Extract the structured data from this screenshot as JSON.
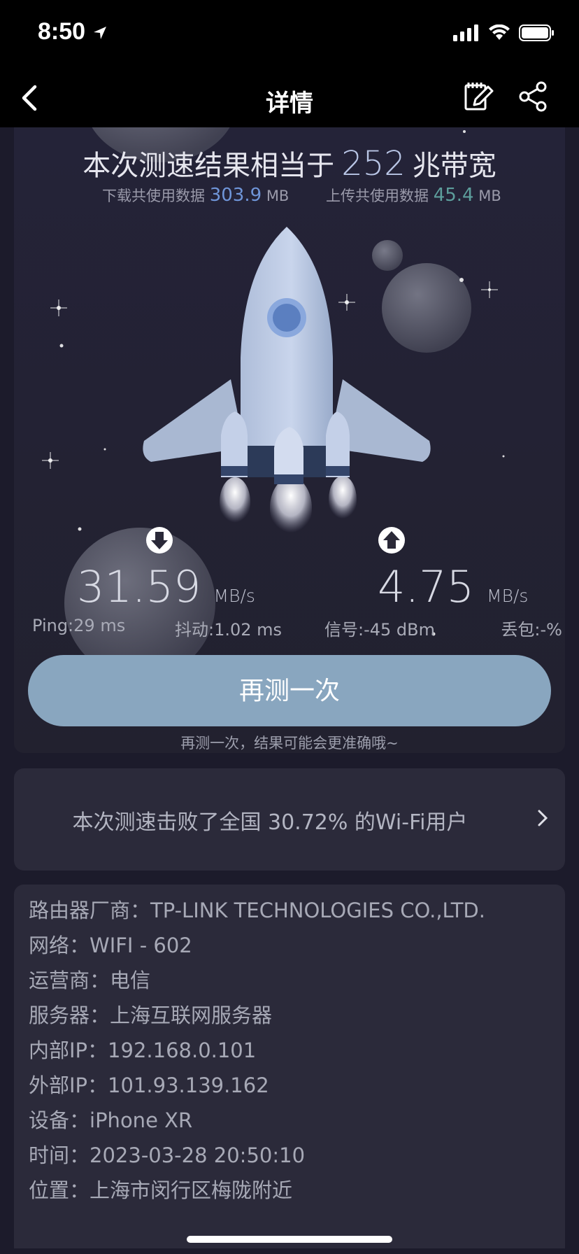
{
  "status": {
    "time": "8:50"
  },
  "nav": {
    "title": "详情"
  },
  "result": {
    "prefix": "本次测速结果相当于",
    "bandwidth": "252",
    "suffix": "兆带宽",
    "download_label": "下载共使用数据",
    "download_value": "303.9",
    "download_unit": "MB",
    "upload_label": "上传共使用数据",
    "upload_value": "45.4",
    "upload_unit": "MB"
  },
  "speeds": {
    "download": "31.59",
    "download_unit": "MB/s",
    "upload": "4.75",
    "upload_unit": "MB/s"
  },
  "metrics": {
    "ping": "Ping:29 ms",
    "jitter": "抖动:1.02 ms",
    "signal": "信号:-45 dBm",
    "loss": "丢包:-%"
  },
  "actions": {
    "retest_label": "再测一次",
    "retest_hint": "再测一次，结果可能会更准确哦~"
  },
  "beat": {
    "text": "本次测速击败了全国 30.72% 的Wi-Fi用户"
  },
  "info": [
    {
      "label": "路由器厂商：",
      "value": "TP-LINK TECHNOLOGIES CO.,LTD."
    },
    {
      "label": "网络：",
      "value": "WIFI - 602"
    },
    {
      "label": "运营商：",
      "value": "电信"
    },
    {
      "label": "服务器：",
      "value": "上海互联网服务器"
    },
    {
      "label": "内部IP：",
      "value": "192.168.0.101"
    },
    {
      "label": "外部IP：",
      "value": "101.93.139.162"
    },
    {
      "label": "设备：",
      "value": "iPhone XR"
    },
    {
      "label": "时间：",
      "value": "2023-03-28 20:50:10"
    },
    {
      "label": "位置：",
      "value": "上海市闵行区梅陇附近"
    }
  ],
  "colors": {
    "accent_blue": "#6f95d8",
    "accent_green": "#5d9e9c",
    "button": "#89a6bf",
    "card": "#2b2a3a"
  },
  "icons": [
    "location-arrow-icon",
    "signal-icon",
    "wifi-icon",
    "battery-icon",
    "back-chevron-icon",
    "edit-notes-icon",
    "share-icon",
    "download-arrow-icon",
    "upload-arrow-icon",
    "chevron-right-icon",
    "rocket-illustration"
  ]
}
